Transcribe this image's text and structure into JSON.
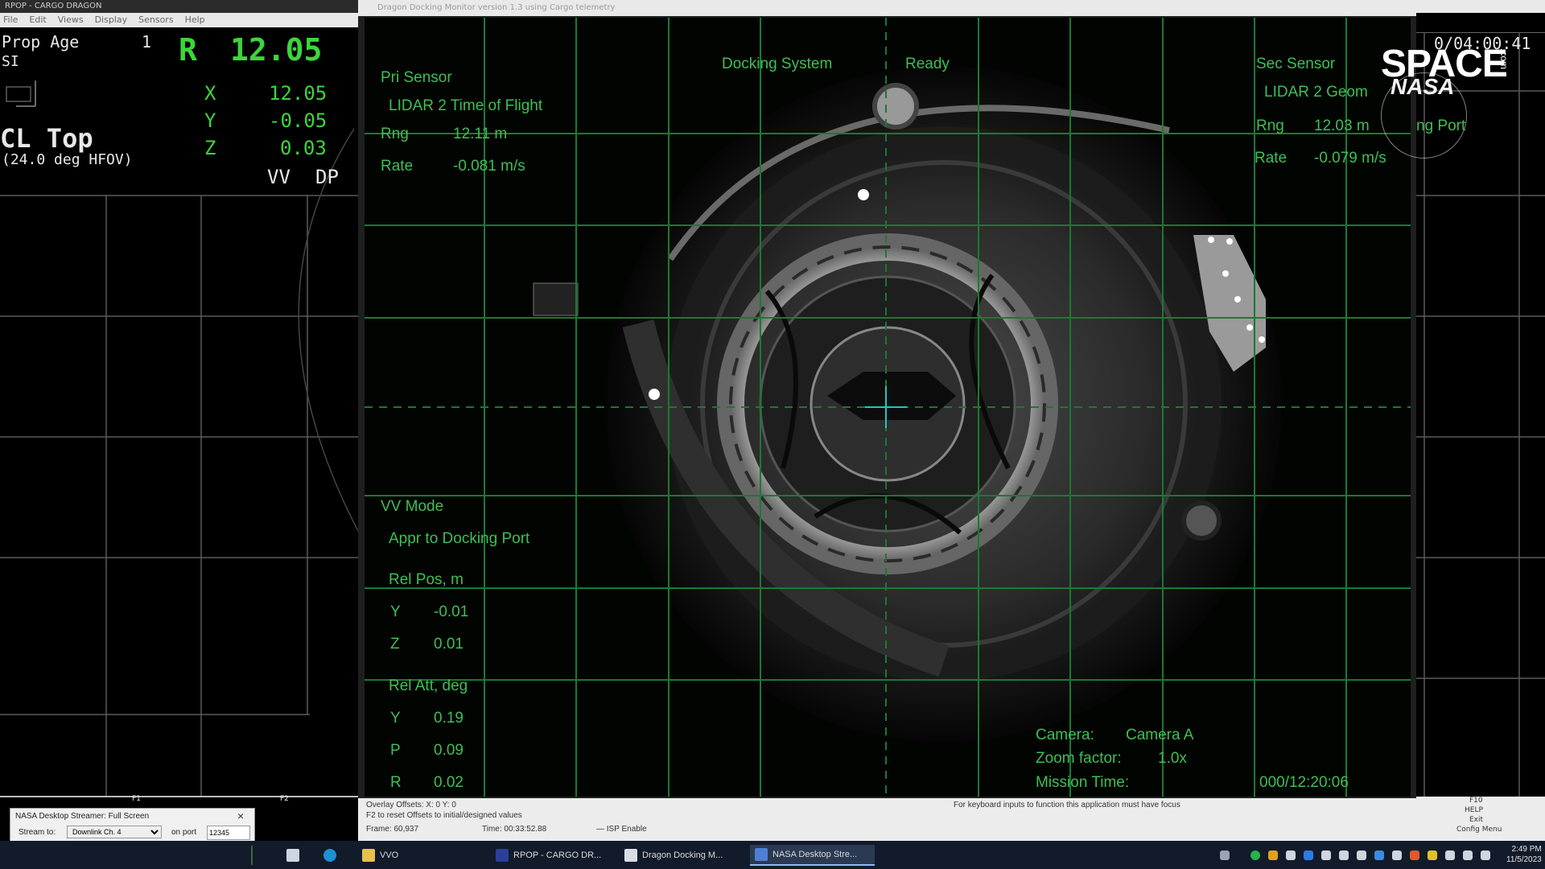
{
  "rpop": {
    "title": "RPOP - CARGO DRAGON",
    "menu": [
      "File",
      "Edit",
      "Views",
      "Display",
      "Sensors",
      "Help"
    ],
    "prop_age_label": "Prop Age",
    "prop_age_value": "1",
    "si_label": "SI",
    "range_label": "R",
    "range_value": "12.05",
    "axes": [
      {
        "label": "X",
        "value": "12.05"
      },
      {
        "label": "Y",
        "value": "-0.05"
      },
      {
        "label": "Z",
        "value": "0.03"
      }
    ],
    "view_name": "CL Top",
    "hfov": "(24.0 deg HFOV)",
    "vv_label": "VV",
    "dp_label": "DP",
    "bottom_marks": [
      "F1",
      "F2"
    ]
  },
  "docking_monitor": {
    "title": "Dragon Docking Monitor version 1.3 using Cargo telemetry",
    "pri_sensor": {
      "heading": "Pri Sensor",
      "name": "LIDAR 2 Time of Flight",
      "rng_label": "Rng",
      "rng_value": "12.11 m",
      "rate_label": "Rate",
      "rate_value": "-0.081 m/s"
    },
    "docking_system": {
      "label": "Docking System",
      "status": "Ready"
    },
    "sec_sensor": {
      "heading": "Sec Sensor",
      "name": "LIDAR 2 Geom",
      "rng_label": "Rng",
      "rng_value": "12.03 m",
      "port_text": "ng Port",
      "rate_label": "Rate",
      "rate_value": "-0.079 m/s"
    },
    "vv_mode": {
      "heading": "VV Mode",
      "phase": "Appr to Docking Port",
      "rel_pos_heading": "Rel Pos, m",
      "rel_pos": [
        {
          "label": "Y",
          "value": "-0.01"
        },
        {
          "label": "Z",
          "value": "0.01"
        }
      ],
      "rel_att_heading": "Rel Att, deg",
      "rel_att": [
        {
          "label": "Y",
          "value": "0.19"
        },
        {
          "label": "P",
          "value": "0.09"
        },
        {
          "label": "R",
          "value": "0.02"
        }
      ]
    },
    "camera": {
      "camera_label": "Camera:",
      "camera_value": "Camera A",
      "zoom_label": "Zoom factor:",
      "zoom_value": "1.0x",
      "mission_label": "Mission Time:",
      "mission_value": "000/12:20:06"
    },
    "status": {
      "overlay": "Overlay Offsets:  X: 0     Y: 0",
      "reset_hint": "F2 to reset Offsets to initial/designed values",
      "frame": "Frame: 60,937",
      "time": "Time: 00:33:52.88",
      "isp": "ISP Enable",
      "focus_hint": "For keyboard inputs to function this application must have focus"
    }
  },
  "right_strip": {
    "clock": "0/04:00:41",
    "menu": [
      "F10",
      "HELP",
      "Exit",
      "Config Menu"
    ]
  },
  "watermark": {
    "line1": "SPACE",
    "line2": "NASA",
    "suffix": ".com"
  },
  "streamer": {
    "title": "NASA Desktop Streamer: Full Screen",
    "stream_label": "Stream to:",
    "stream_value": "Downlink Ch. 4",
    "port_label": "on port",
    "port_value": "12345"
  },
  "taskbar": {
    "items": [
      {
        "label": "VVO"
      },
      {
        "label": "RPOP - CARGO DR..."
      },
      {
        "label": "Dragon Docking M..."
      },
      {
        "label": "NASA Desktop Stre..."
      }
    ],
    "clock_time": "2:49 PM",
    "clock_date": "11/5/2023"
  },
  "colors": {
    "hud_green": "#3fbf52",
    "grid_green": "#1a7a32",
    "rpop_green": "#3bd63b"
  }
}
